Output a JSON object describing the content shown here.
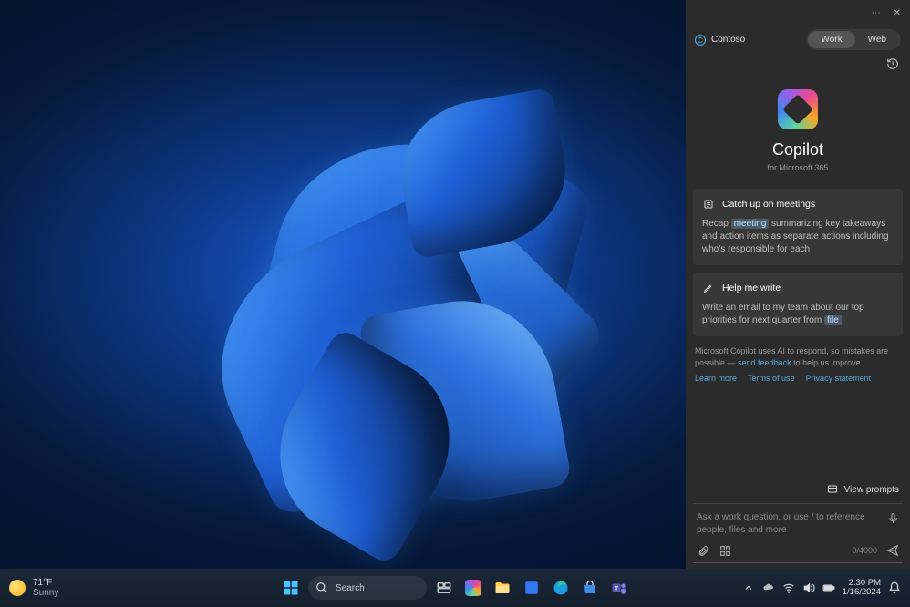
{
  "copilot": {
    "org": "Contoso",
    "tabs": {
      "work": "Work",
      "web": "Web"
    },
    "title": "Copilot",
    "subtitle": "for Microsoft 365",
    "cards": [
      {
        "icon": "list-icon",
        "title": "Catch up on meetings",
        "body_pre": "Recap ",
        "body_token": "meeting",
        "body_post": " summarizing key takeaways and action items as separate actions including who's responsible for each"
      },
      {
        "icon": "compose-icon",
        "title": "Help me write",
        "body_pre": "Write an email to my team about our top priorities for next quarter from ",
        "body_token": "file",
        "body_post": ""
      }
    ],
    "disclaimer_pre": "Microsoft Copilot uses AI to respond, so mistakes are possible — ",
    "disclaimer_link": "send feedback",
    "disclaimer_post": " to help us improve.",
    "links": {
      "learn": "Learn more",
      "terms": "Terms of use",
      "privacy": "Privacy statement"
    },
    "view_prompts": "View prompts",
    "input_placeholder": "Ask a work question, or use / to reference people, files and more",
    "char_count": "0/4000"
  },
  "taskbar": {
    "weather": {
      "temp": "71°F",
      "cond": "Sunny"
    },
    "search_placeholder": "Search",
    "time": "2:30 PM",
    "date": "1/16/2024"
  }
}
